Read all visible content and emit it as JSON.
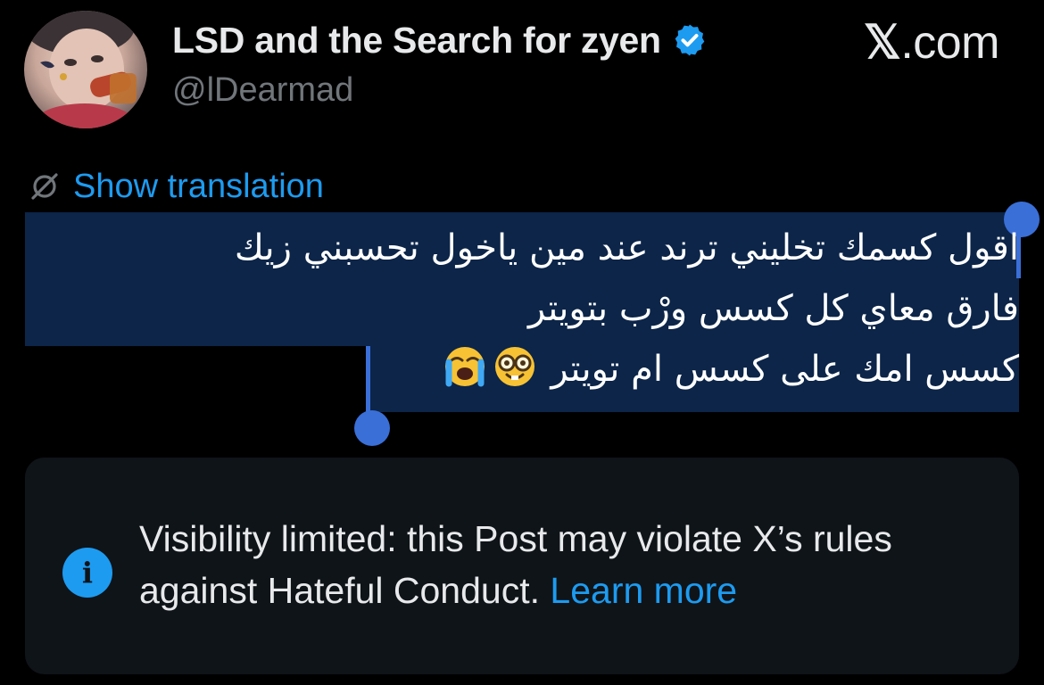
{
  "author": {
    "display_name": "LSD and the Search for zyen",
    "handle": "@lDearmad",
    "verified": true
  },
  "site": {
    "label": ".com",
    "logo_glyph": "𝕏"
  },
  "translation": {
    "label": "Show translation",
    "icon": "translate-globe-icon"
  },
  "post": {
    "lines": [
      "اقول كسمك تخليني ترند عند مين ياخول تحسبني زيك",
      "فارق معاي كل كسس ورْب بتويتر",
      "كسس امك على كسس ام تويتر"
    ],
    "line3_emojis": [
      "nerd-face-emoji",
      "loudly-crying-face-emoji"
    ],
    "selection_color": "#0c2549",
    "selection_handle_color": "#3a6fd8"
  },
  "notice": {
    "text": "Visibility limited: this Post may violate X’s rules against Hateful Conduct.",
    "link_label": "Learn more",
    "icon": "info-icon",
    "icon_glyph": "i"
  },
  "colors": {
    "background": "#000000",
    "accent": "#1d9bf0",
    "muted_text": "#71767b",
    "card_background": "#0f1419"
  }
}
